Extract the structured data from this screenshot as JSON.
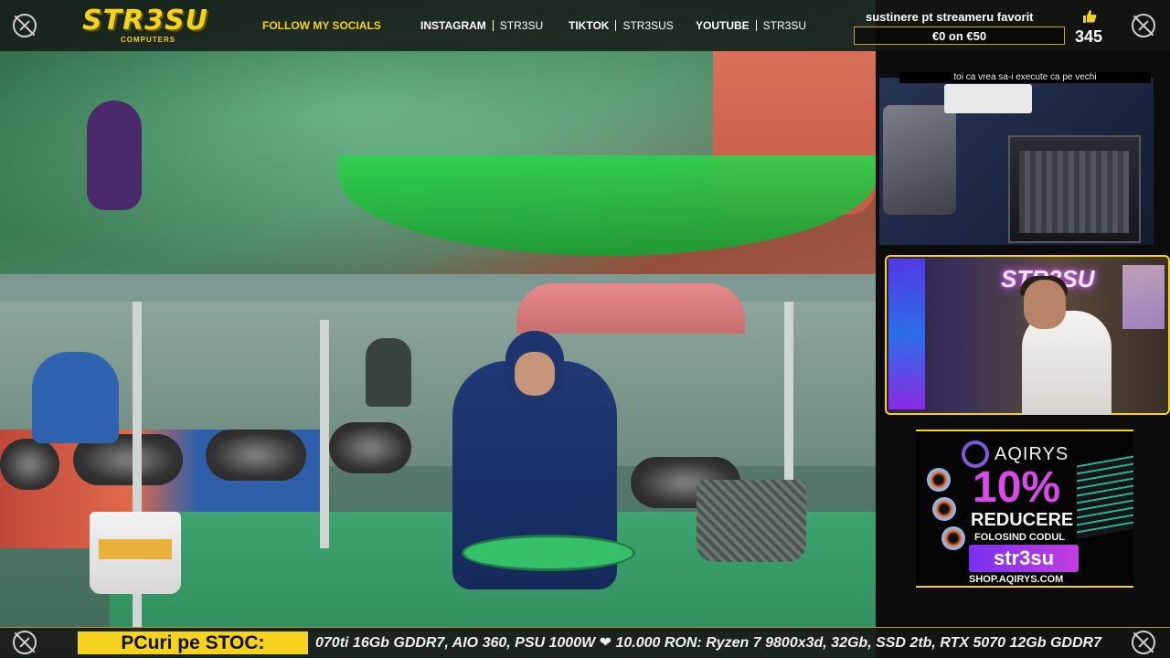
{
  "header": {
    "logo_main": "STR3SU",
    "logo_sub": "COMPUTERS",
    "follow_label": "FOLLOW MY SOCIALS",
    "socials": [
      {
        "network": "INSTAGRAM",
        "handle": "STR3SU"
      },
      {
        "network": "TIKTOK",
        "handle": "STR3SUS"
      },
      {
        "network": "YOUTUBE",
        "handle": "STR3SU"
      }
    ],
    "donation_title": "sustinere pt streameru favorit",
    "donation_progress": "€0 on €50",
    "donation_fraction": 0,
    "likes_count": "345"
  },
  "desk_cam": {
    "caption": "toi ca vrea sa-i execute ca pe vechi"
  },
  "face_cam": {
    "neon_sign": "STR3SU"
  },
  "sponsor": {
    "brand": "AQIRYS",
    "discount": "10%",
    "headline": "REDUCERE",
    "subline": "FOLOSIND CODUL",
    "code": "str3su",
    "url": "SHOP.AQIRYS.COM"
  },
  "ticker": {
    "label": "PCuri pe STOC:",
    "text": "070ti 16Gb GDDR7, AIO 360, PSU 1000W ❤ 10.000 RON: Ryzen 7 9800x3d, 32Gb, SSD 2tb, RTX 5070 12Gb GDDR7"
  },
  "colors": {
    "accent": "#f5d21c",
    "sponsor_purple": "#d94ae6"
  },
  "icons": {
    "corner": "crosshair-circle-icon",
    "likes": "thumbs-up-icon"
  }
}
